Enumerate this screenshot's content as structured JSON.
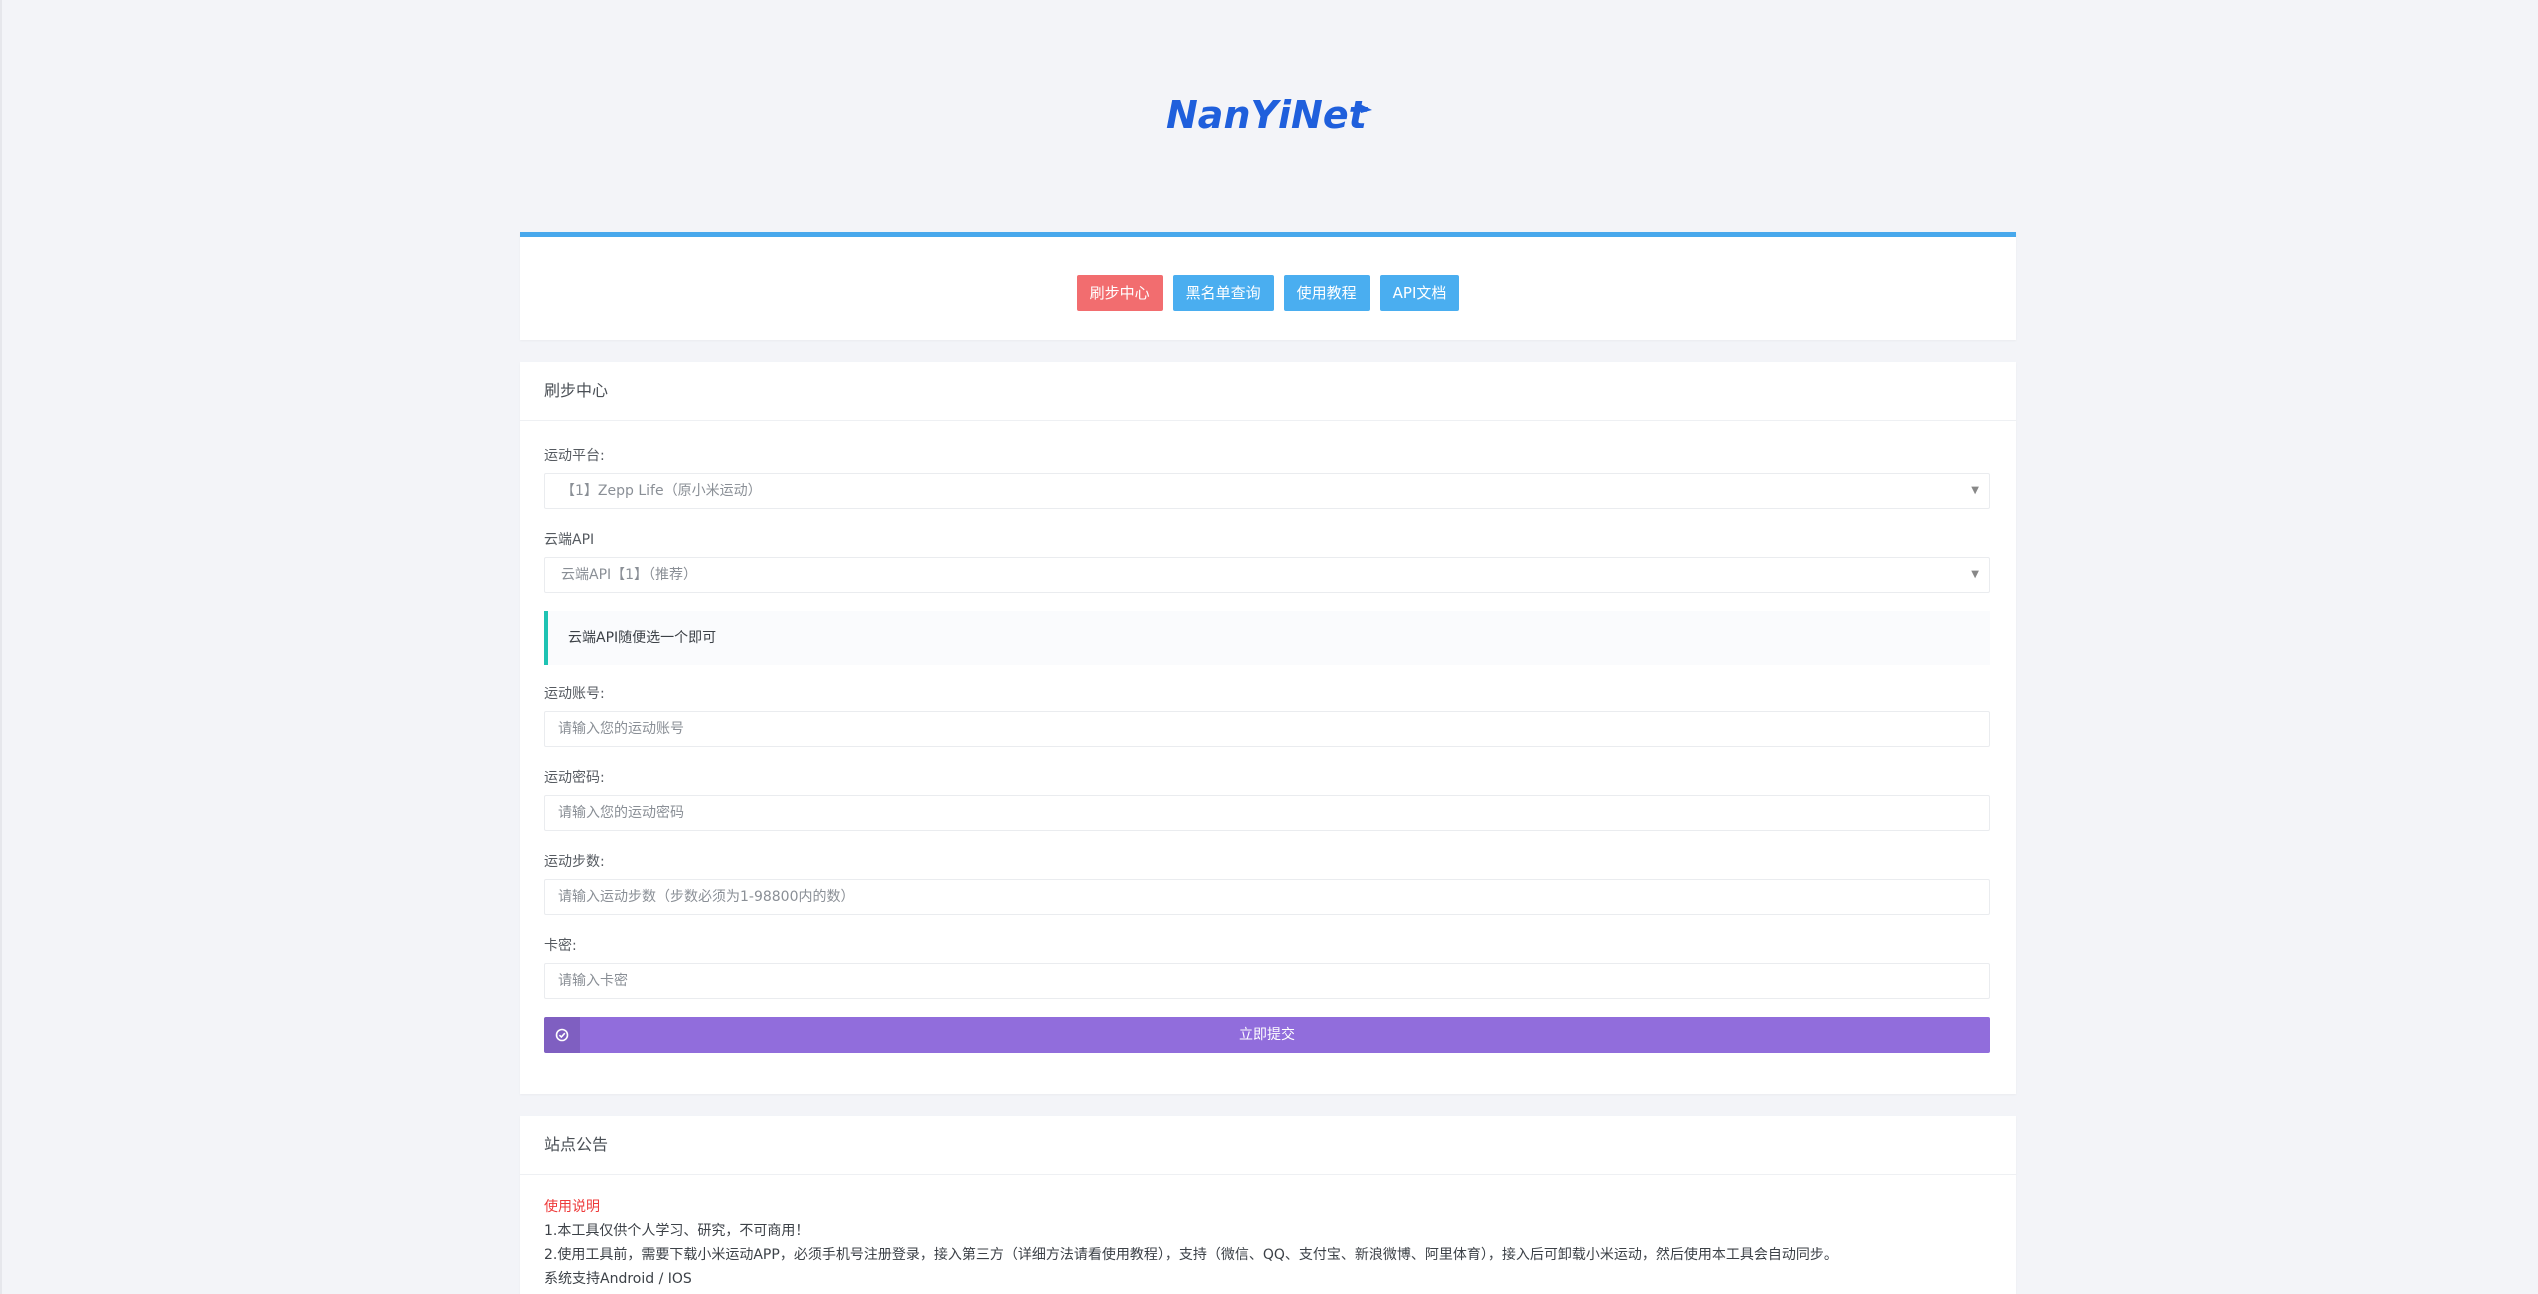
{
  "brand": {
    "logo_text": "NanYiNet",
    "logo_color": "#1f5fdc"
  },
  "nav": {
    "items": [
      {
        "label": "刷步中心",
        "active": true
      },
      {
        "label": "黑名单查询",
        "active": false
      },
      {
        "label": "使用教程",
        "active": false
      },
      {
        "label": "API文档",
        "active": false
      }
    ]
  },
  "form": {
    "title": "刷步中心",
    "platform": {
      "label": "运动平台:",
      "selected": "【1】Zepp Life（原小米运动）"
    },
    "api": {
      "label": "云端API",
      "selected": "云端API【1】（推荐）"
    },
    "hint": "云端API随便选一个即可",
    "account": {
      "label": "运动账号:",
      "placeholder": "请输入您的运动账号"
    },
    "password": {
      "label": "运动密码:",
      "placeholder": "请输入您的运动密码"
    },
    "steps": {
      "label": "运动步数:",
      "placeholder": "请输入运动步数（步数必须为1-98800内的数）"
    },
    "card_key": {
      "label": "卡密:",
      "placeholder": "请输入卡密"
    },
    "submit_label": "立即提交"
  },
  "notice": {
    "title": "站点公告",
    "heading": "使用说明",
    "lines": [
      "1.本工具仅供个人学习、研究，不可商用！",
      "2.使用工具前，需要下载小米运动APP，必须手机号注册登录，接入第三方（详细方法请看使用教程），支持（微信、QQ、支付宝、新浪微博、阿里体育），接入后可卸载小米运动，然后使用本工具会自动同步。",
      "系统支持Android / IOS"
    ]
  },
  "colors": {
    "accent_top": "#48a8ec",
    "nav_active": "#f26d6f",
    "nav_normal": "#4aaef0",
    "submit": "#916ddc",
    "callout_border": "#1ec3b3",
    "notice_heading": "#ee3b3b"
  }
}
